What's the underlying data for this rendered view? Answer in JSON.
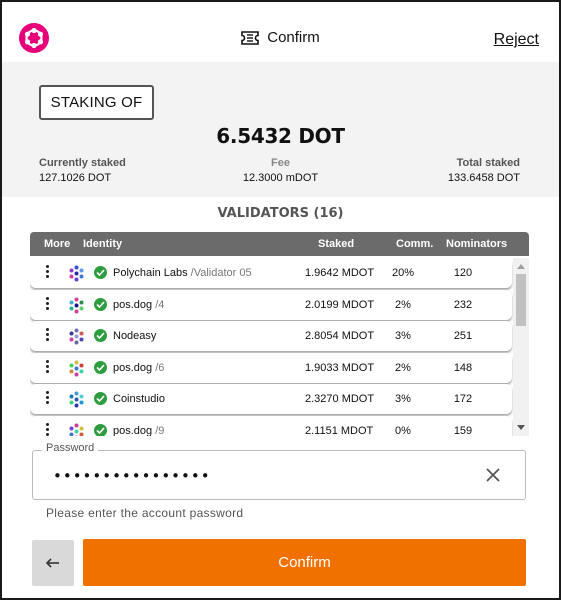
{
  "header": {
    "title": "Confirm",
    "reject_label": "Reject",
    "brand_color": "#e6007a"
  },
  "summary": {
    "badge": "STAKING OF",
    "amount": "6.5432  DOT",
    "currently_staked_label": "Currently staked",
    "currently_staked_value": "127.1026 DOT",
    "fee_label": "Fee",
    "fee_value": "12.3000 mDOT",
    "total_staked_label": "Total staked",
    "total_staked_value": "133.6458 DOT"
  },
  "validators": {
    "title": "VALIDATORS (16)",
    "columns": {
      "more": "More",
      "identity": "Identity",
      "staked": "Staked",
      "comm": "Comm.",
      "nominators": "Nominators"
    },
    "rows": [
      {
        "name": "Polychain Labs",
        "sub": "/Validator 05",
        "staked": "1.9642 MDOT",
        "comm": "20%",
        "nominators": "120"
      },
      {
        "name": "pos.dog",
        "sub": "/4",
        "staked": "2.0199 MDOT",
        "comm": "2%",
        "nominators": "232"
      },
      {
        "name": "Nodeasy",
        "sub": "",
        "staked": "2.8054 MDOT",
        "comm": "3%",
        "nominators": "251"
      },
      {
        "name": "pos.dog",
        "sub": "/6",
        "staked": "1.9033 MDOT",
        "comm": "2%",
        "nominators": "148"
      },
      {
        "name": "Coinstudio",
        "sub": "",
        "staked": "2.3270 MDOT",
        "comm": "3%",
        "nominators": "172"
      },
      {
        "name": "pos.dog",
        "sub": "/9",
        "staked": "2.1151 MDOT",
        "comm": "0%",
        "nominators": "159"
      }
    ]
  },
  "password": {
    "label": "Password",
    "value": "••••••••••••••••",
    "hint": "Please enter the account password"
  },
  "footer": {
    "back_icon": "arrow-left-icon",
    "confirm_label": "Confirm",
    "confirm_color": "#f07000"
  }
}
